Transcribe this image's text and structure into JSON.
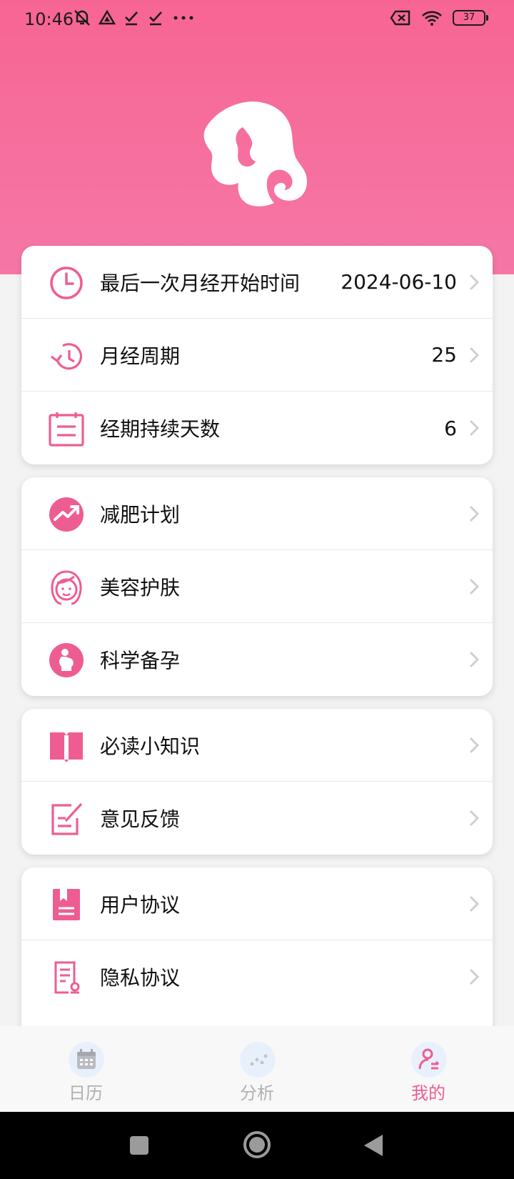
{
  "status_bar": {
    "time": "10:46",
    "battery": "37"
  },
  "colors": {
    "accent": "#f76593",
    "icon_pink": "#ee5d92",
    "tab_active": "#ee5d92",
    "tab_inactive": "#b0b0b0"
  },
  "cards": [
    {
      "rows": [
        {
          "icon": "clock-icon",
          "label": "最后一次月经开始时间",
          "value": "2024-06-10"
        },
        {
          "icon": "cycle-timer-icon",
          "label": "月经周期",
          "value": "25"
        },
        {
          "icon": "calendar-note-icon",
          "label": "经期持续天数",
          "value": "6"
        }
      ]
    },
    {
      "rows": [
        {
          "icon": "trend-chart-icon",
          "label": "减肥计划"
        },
        {
          "icon": "face-icon",
          "label": "美容护肤"
        },
        {
          "icon": "pregnancy-icon",
          "label": "科学备孕"
        }
      ]
    },
    {
      "rows": [
        {
          "icon": "book-icon",
          "label": "必读小知识"
        },
        {
          "icon": "feedback-edit-icon",
          "label": "意见反馈"
        }
      ]
    },
    {
      "rows": [
        {
          "icon": "user-agreement-icon",
          "label": "用户协议"
        },
        {
          "icon": "privacy-doc-icon",
          "label": "隐私协议"
        }
      ]
    }
  ],
  "tabs": [
    {
      "icon": "calendar-icon",
      "label": "日历",
      "active": false
    },
    {
      "icon": "analysis-icon",
      "label": "分析",
      "active": false
    },
    {
      "icon": "profile-icon",
      "label": "我的",
      "active": true
    }
  ]
}
